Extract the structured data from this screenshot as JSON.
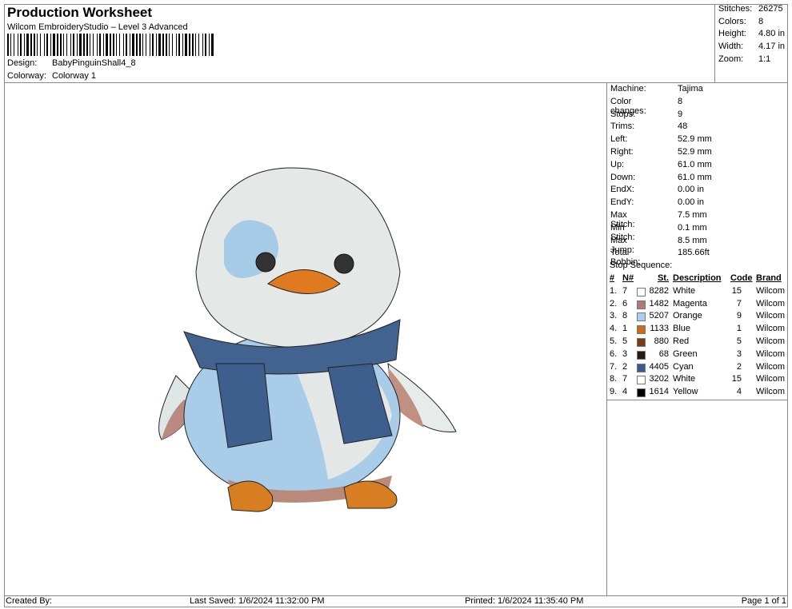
{
  "header": {
    "title": "Production Worksheet",
    "subtitle": "Wilcom EmbroideryStudio – Level 3 Advanced",
    "design_label": "Design:",
    "design": "BabyPinguinShall4_8",
    "colorway_label": "Colorway:",
    "colorway": "Colorway 1"
  },
  "stats": [
    {
      "k": "Stitches:",
      "v": "26275"
    },
    {
      "k": "Colors:",
      "v": "8"
    },
    {
      "k": "Height:",
      "v": "4.80 in"
    },
    {
      "k": "Width:",
      "v": "4.17 in"
    },
    {
      "k": "Zoom:",
      "v": "1:1"
    }
  ],
  "machine": [
    {
      "k": "Machine:",
      "v": "Tajima"
    },
    {
      "k": "Color changes:",
      "v": "8"
    },
    {
      "k": "Stops:",
      "v": "9"
    },
    {
      "k": "Trims:",
      "v": "48"
    },
    {
      "k": "Left:",
      "v": "52.9 mm"
    },
    {
      "k": "Right:",
      "v": "52.9 mm"
    },
    {
      "k": "Up:",
      "v": "61.0 mm"
    },
    {
      "k": "Down:",
      "v": "61.0 mm"
    },
    {
      "k": "EndX:",
      "v": "0.00 in"
    },
    {
      "k": "EndY:",
      "v": "0.00 in"
    },
    {
      "k": "Max Stitch:",
      "v": "7.5 mm"
    },
    {
      "k": "Min Stitch:",
      "v": "0.1 mm"
    },
    {
      "k": "Max Jump:",
      "v": "8.5 mm"
    },
    {
      "k": "Total Bobbin:",
      "v": "185.66ft"
    }
  ],
  "stop_sequence": {
    "title": "Stop Sequence:",
    "headers": [
      "#",
      "N#",
      "St.",
      "Description",
      "Code",
      "Brand"
    ],
    "rows": [
      {
        "n": "1.",
        "nn": "7",
        "color": "#ffffff",
        "st": "8282",
        "desc": "White",
        "code": "15",
        "brand": "Wilcom"
      },
      {
        "n": "2.",
        "nn": "6",
        "color": "#b07a78",
        "st": "1482",
        "desc": "Magenta",
        "code": "7",
        "brand": "Wilcom"
      },
      {
        "n": "3.",
        "nn": "8",
        "color": "#a8d0f0",
        "st": "5207",
        "desc": "Orange",
        "code": "9",
        "brand": "Wilcom"
      },
      {
        "n": "4.",
        "nn": "1",
        "color": "#d0681a",
        "st": "1133",
        "desc": "Blue",
        "code": "1",
        "brand": "Wilcom"
      },
      {
        "n": "5.",
        "nn": "5",
        "color": "#7a3a12",
        "st": "880",
        "desc": "Red",
        "code": "5",
        "brand": "Wilcom"
      },
      {
        "n": "6.",
        "nn": "3",
        "color": "#2a1a14",
        "st": "68",
        "desc": "Green",
        "code": "3",
        "brand": "Wilcom"
      },
      {
        "n": "7.",
        "nn": "2",
        "color": "#3d5a90",
        "st": "4405",
        "desc": "Cyan",
        "code": "2",
        "brand": "Wilcom"
      },
      {
        "n": "8.",
        "nn": "7",
        "color": "#ffffff",
        "st": "3202",
        "desc": "White",
        "code": "15",
        "brand": "Wilcom"
      },
      {
        "n": "9.",
        "nn": "4",
        "color": "#000000",
        "st": "1614",
        "desc": "Yellow",
        "code": "4",
        "brand": "Wilcom"
      }
    ]
  },
  "footer": {
    "created": "Created By:",
    "saved": "Last Saved: 1/6/2024 11:32:00 PM",
    "printed": "Printed: 1/6/2024 11:35:40 PM",
    "page": "Page 1 of 1"
  }
}
